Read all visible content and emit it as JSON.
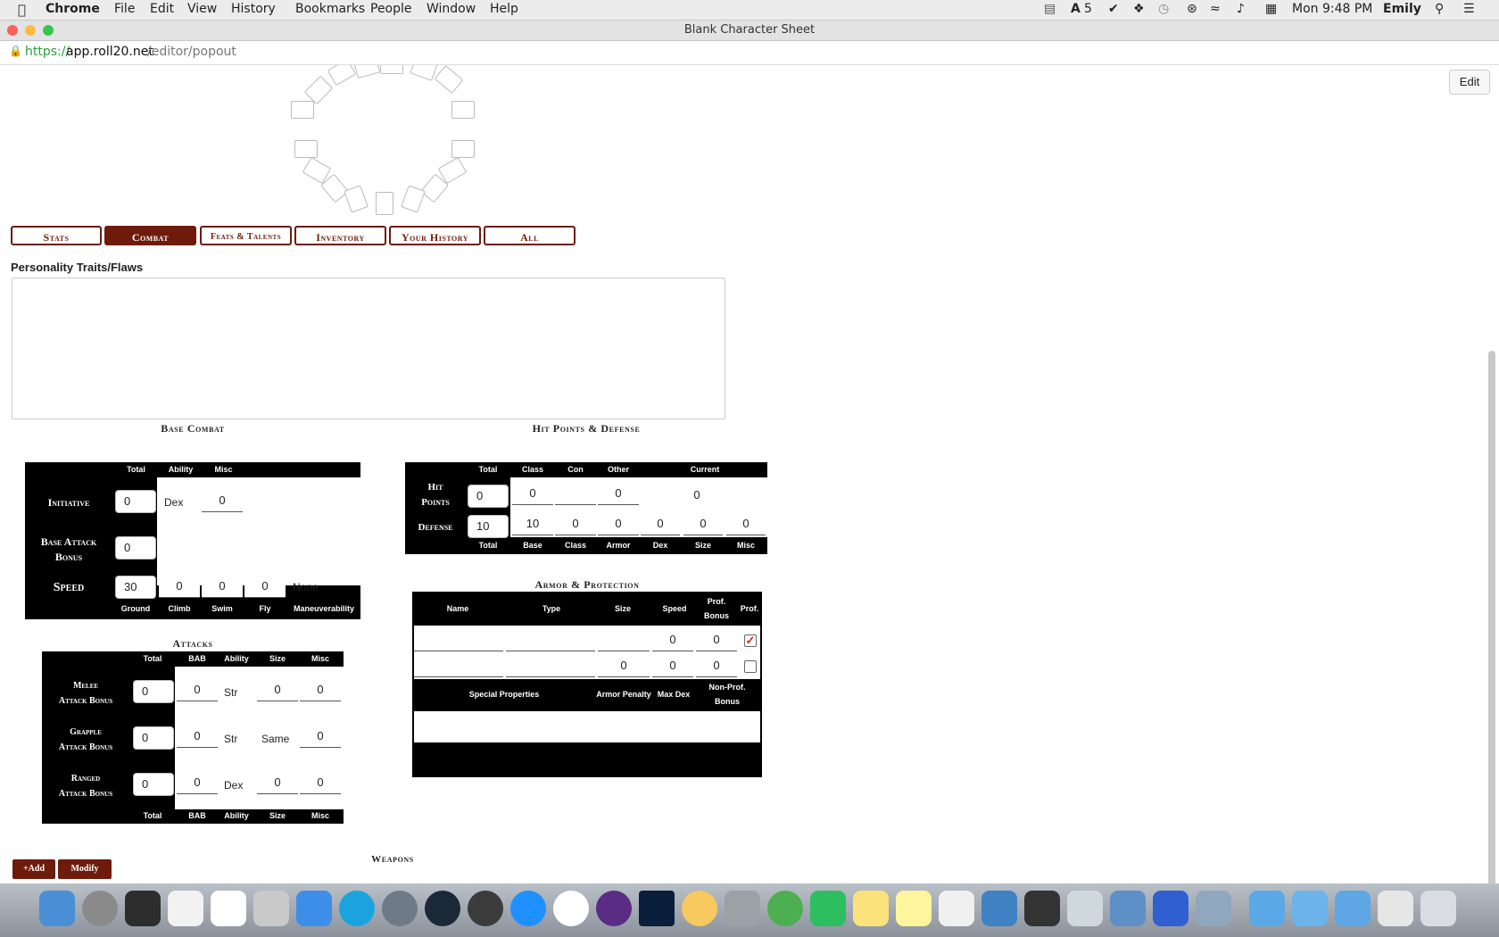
{
  "menubar": {
    "apple": "",
    "app": "Chrome",
    "items": [
      "File",
      "Edit",
      "View",
      "History",
      "Bookmarks",
      "People",
      "Window",
      "Help"
    ],
    "status_adobe": "5",
    "clock": "Mon 9:48 PM",
    "user": "Emily"
  },
  "window": {
    "title": "Blank Character Sheet",
    "url_scheme": "https://",
    "url_host": "app.roll20.net",
    "url_path": "/editor/popout"
  },
  "toolbar": {
    "edit_label": "Edit"
  },
  "tabs": [
    {
      "label": "Stats",
      "active": false
    },
    {
      "label": "Combat",
      "active": true
    },
    {
      "label": "Feats & Talents",
      "active": false
    },
    {
      "label": "Inventory",
      "active": false
    },
    {
      "label": "Your History",
      "active": false
    },
    {
      "label": "All",
      "active": false
    }
  ],
  "personality": {
    "label": "Personality Traits/Flaws",
    "value": ""
  },
  "base_combat": {
    "title": "Base Combat",
    "headers": {
      "total": "Total",
      "ability": "Ability",
      "misc": "Misc"
    },
    "initiative": {
      "label": "Initiative",
      "total": "0",
      "ability": "Dex",
      "misc": "0"
    },
    "bab": {
      "label1": "Base Attack",
      "label2": "Bonus",
      "total": "0"
    },
    "speed": {
      "label": "Speed",
      "ground": "30",
      "climb": "0",
      "swim": "0",
      "fly": "0",
      "maneuverability": "None"
    },
    "footer": {
      "ground": "Ground",
      "climb": "Climb",
      "swim": "Swim",
      "fly": "Fly",
      "maneuverability": "Maneuverability"
    }
  },
  "attacks": {
    "title": "Attacks",
    "headers": {
      "total": "Total",
      "bab": "BAB",
      "ability": "Ability",
      "size": "Size",
      "misc": "Misc"
    },
    "rows": [
      {
        "l1": "Melee",
        "l2": "Attack Bonus",
        "total": "0",
        "bab": "0",
        "ability": "Str",
        "size": "0",
        "misc": "0"
      },
      {
        "l1": "Grapple",
        "l2": "Attack Bonus",
        "total": "0",
        "bab": "0",
        "ability": "Str",
        "size": "Same",
        "misc": "0"
      },
      {
        "l1": "Ranged",
        "l2": "Attack Bonus",
        "total": "0",
        "bab": "0",
        "ability": "Dex",
        "size": "0",
        "misc": "0"
      }
    ]
  },
  "hp_def": {
    "title": "Hit Points & Defense",
    "headers": {
      "total": "Total",
      "class": "Class",
      "con": "Con",
      "other": "Other",
      "current": "Current"
    },
    "hp": {
      "label1": "Hit",
      "label2": "Points",
      "total": "0",
      "class": "0",
      "con": "",
      "other": "0",
      "current": "0"
    },
    "defense": {
      "label": "Defense",
      "total": "10",
      "base": "10",
      "class": "0",
      "armor": "0",
      "dex": "0",
      "size": "0",
      "misc": "0"
    },
    "footer": {
      "total": "Total",
      "base": "Base",
      "class": "Class",
      "armor": "Armor",
      "dex": "Dex",
      "size": "Size",
      "misc": "Misc"
    }
  },
  "armor": {
    "title": "Armor & Protection",
    "headers": {
      "name": "Name",
      "type": "Type",
      "size": "Size",
      "speed": "Speed",
      "prof_bonus1": "Prof.",
      "prof_bonus2": "Bonus",
      "prof": "Prof."
    },
    "rows": [
      {
        "name": "",
        "type": "",
        "size": "",
        "speed": "0",
        "prof_bonus": "0",
        "prof": true
      },
      {
        "name": "",
        "type": "",
        "size": "0",
        "speed": "0",
        "prof_bonus": "0",
        "prof": false
      }
    ],
    "footer": {
      "special": "Special Properties",
      "penalty": "Armor Penalty",
      "maxdex": "Max Dex",
      "nonprof1": "Non-Prof.",
      "nonprof2": "Bonus"
    }
  },
  "weapons": {
    "title": "Weapons",
    "add": "+Add",
    "modify": "Modify"
  },
  "colors": {
    "accent": "#6e1b0b",
    "panel": "#000000"
  }
}
